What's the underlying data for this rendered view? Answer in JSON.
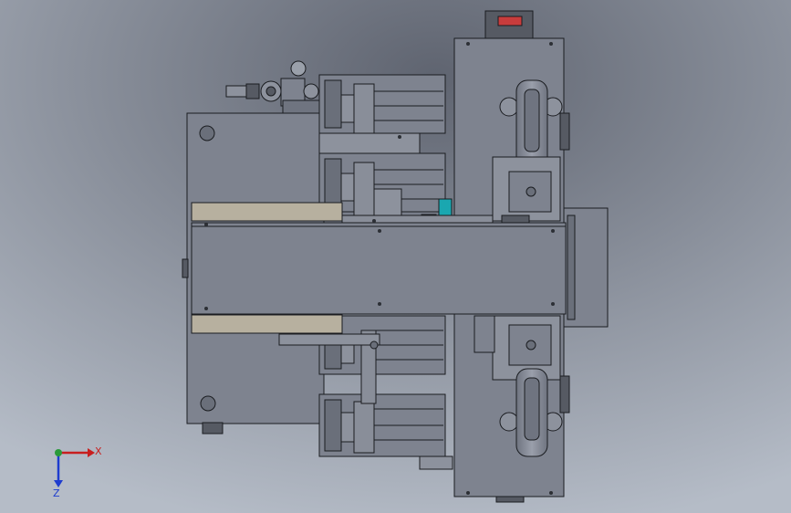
{
  "viewport": {
    "background_top": "#5f6470",
    "background_bottom": "#b5bcc7"
  },
  "colors": {
    "steel": "#7e838f",
    "steel_light": "#8d929d",
    "steel_dark": "#565a63",
    "edge": "#1a1c20",
    "beige": "#b7b09f",
    "cyan_part": "#1aa7b0",
    "yellow_part": "#b8b23a",
    "indicator_red": "#c83c3c",
    "axis_x": "#c81e1e",
    "axis_y": "#2a9a3a",
    "axis_z": "#1e3ccf"
  },
  "triad": {
    "x_label": "X",
    "z_label": "Z"
  }
}
